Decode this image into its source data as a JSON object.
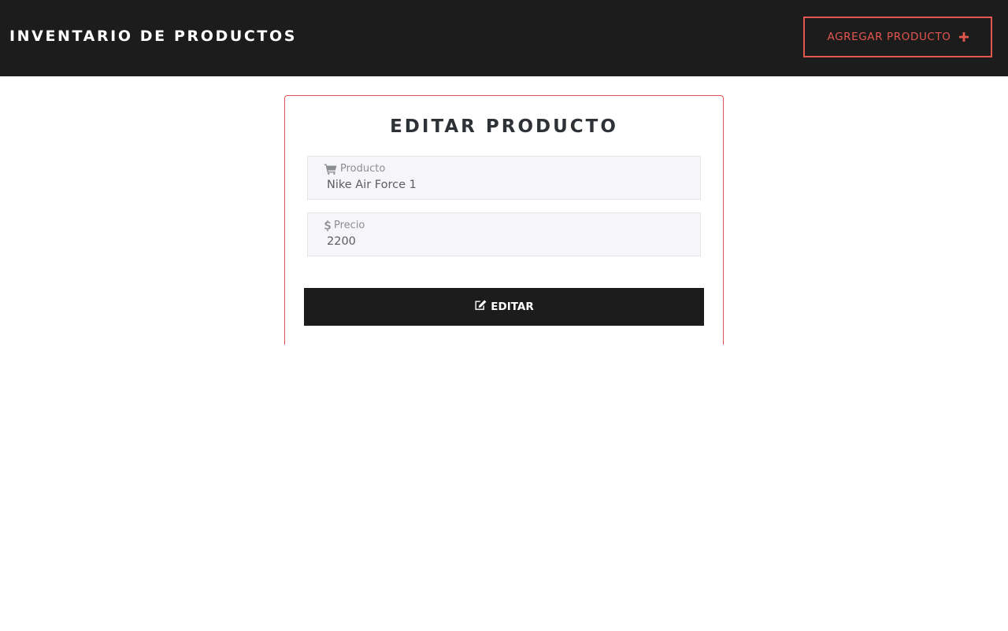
{
  "navbar": {
    "brand": "INVENTARIO DE PRODUCTOS",
    "add_button_label": "AGREGAR PRODUCTO",
    "add_button_icon": "plus-icon"
  },
  "form": {
    "title": "EDITAR PRODUCTO",
    "fields": [
      {
        "label": "Producto",
        "icon": "shopping-cart-icon",
        "value": "Nike Air Force 1"
      },
      {
        "label": "Precio",
        "icon": "dollar-icon",
        "value": "2200"
      }
    ],
    "submit_label": "EDITAR",
    "submit_icon": "edit-icon"
  },
  "colors": {
    "navbar_bg": "#1c1c1c",
    "accent": "#e2564e",
    "field_bg": "#f6f6f8",
    "button_bg": "#1c1c1c"
  }
}
